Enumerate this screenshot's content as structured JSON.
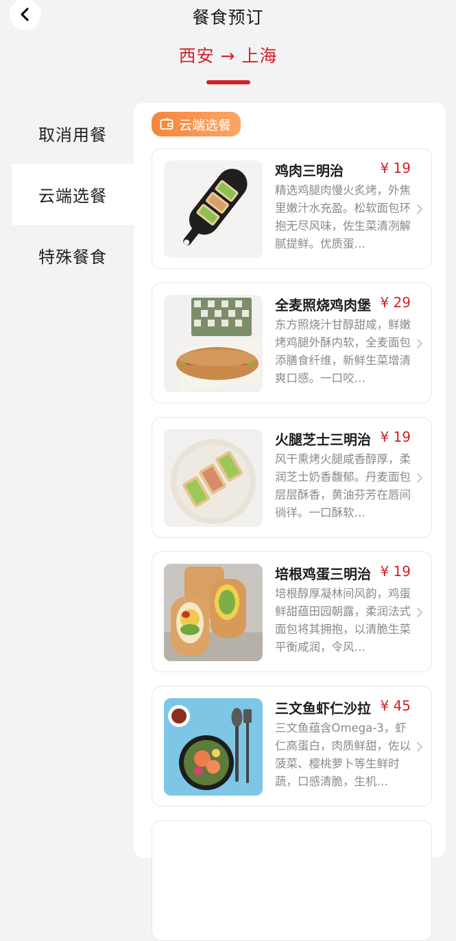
{
  "header": {
    "title": "餐食预订",
    "route": "西安 → 上海"
  },
  "sidebar": {
    "items": [
      {
        "label": "取消用餐",
        "active": false
      },
      {
        "label": "云端选餐",
        "active": true
      },
      {
        "label": "特殊餐食",
        "active": false
      }
    ]
  },
  "section": {
    "tag_label": "云端选餐"
  },
  "products": [
    {
      "name": "鸡肉三明治",
      "price": "¥ 19",
      "desc": "精选鸡腿肉慢火炙烤，外焦里嫩汁水充盈。松软面包环抱无尽风味，佐生菜清冽解腻提鲜。优质蛋…"
    },
    {
      "name": "全麦照烧鸡肉堡",
      "price": "¥ 29",
      "desc": "东方照烧汁甘醇甜咸，鲜嫩烤鸡腿外酥内软，全麦面包添膳食纤维，新鲜生菜增清爽口感。一口咬…"
    },
    {
      "name": "火腿芝士三明治",
      "price": "¥ 19",
      "desc": "风干熏烤火腿咸香醇厚，柔润芝士奶香馥郁。丹麦面包层层酥香，黄油芬芳在唇间徜徉。一口酥软…"
    },
    {
      "name": "培根鸡蛋三明治",
      "price": "¥ 19",
      "desc": "培根醇厚凝林间风韵，鸡蛋鲜甜蕴田园朝露，柔润法式面包将其拥抱，以清脆生菜平衡咸润，令风…"
    },
    {
      "name": "三文鱼虾仁沙拉",
      "price": "¥ 45",
      "desc": "三文鱼蕴含Omega-3，虾仁高蛋白，肉质鲜甜，佐以菠菜、樱桃萝卜等生鲜时蔬，口感清脆，生机…"
    }
  ],
  "colors": {
    "accent": "#d32029",
    "tag": "#f5863a",
    "background": "#f3f3f5"
  }
}
